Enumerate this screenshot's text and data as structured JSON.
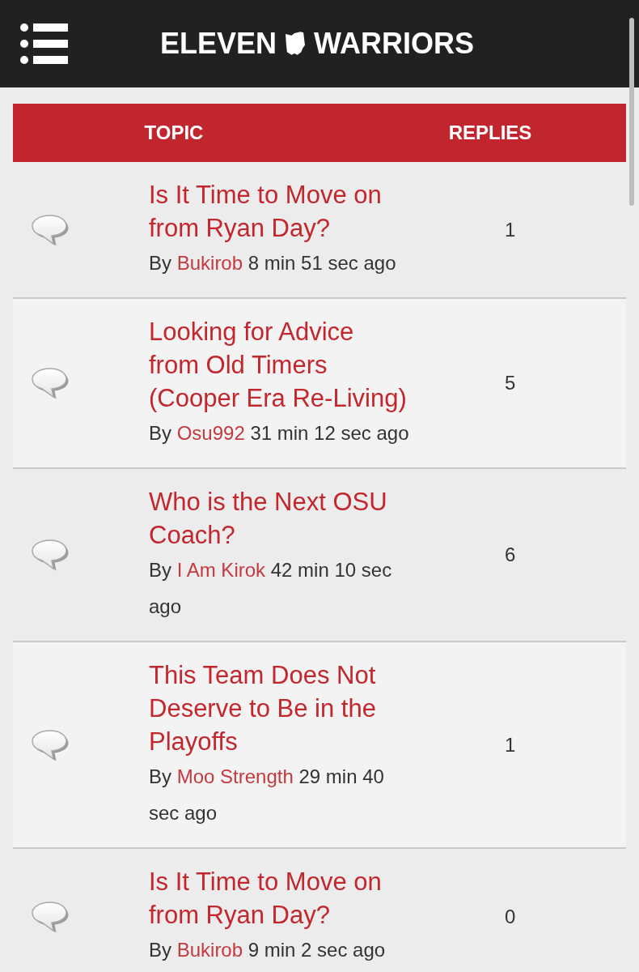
{
  "header": {
    "logo": {
      "word_1": "ELEVEN",
      "word_2": "WARRIORS"
    }
  },
  "table": {
    "columns": [
      "TOPIC",
      "REPLIES"
    ],
    "rows": [
      {
        "title": "Is It Time to Move on from Ryan Day?",
        "by": "By",
        "author": "Bukirob",
        "time": "8 min 51 sec ago",
        "replies": "1"
      },
      {
        "title": "Looking for Advice from Old Timers (Cooper Era Re-Living)",
        "by": "By",
        "author": "Osu992",
        "time": "31 min 12 sec ago",
        "replies": "5"
      },
      {
        "title": "Who is the Next OSU Coach?",
        "by": "By",
        "author": "I Am Kirok",
        "time": "42 min 10 sec ago",
        "replies": "6"
      },
      {
        "title": "This Team Does Not Deserve to Be in the Playoffs",
        "by": "By",
        "author": "Moo Strength",
        "time": "29 min 40 sec ago",
        "replies": "1"
      },
      {
        "title": "Is It Time to Move on from Ryan Day?",
        "by": "By",
        "author": "Bukirob",
        "time": "9 min 2 sec ago",
        "replies": "0"
      }
    ]
  }
}
